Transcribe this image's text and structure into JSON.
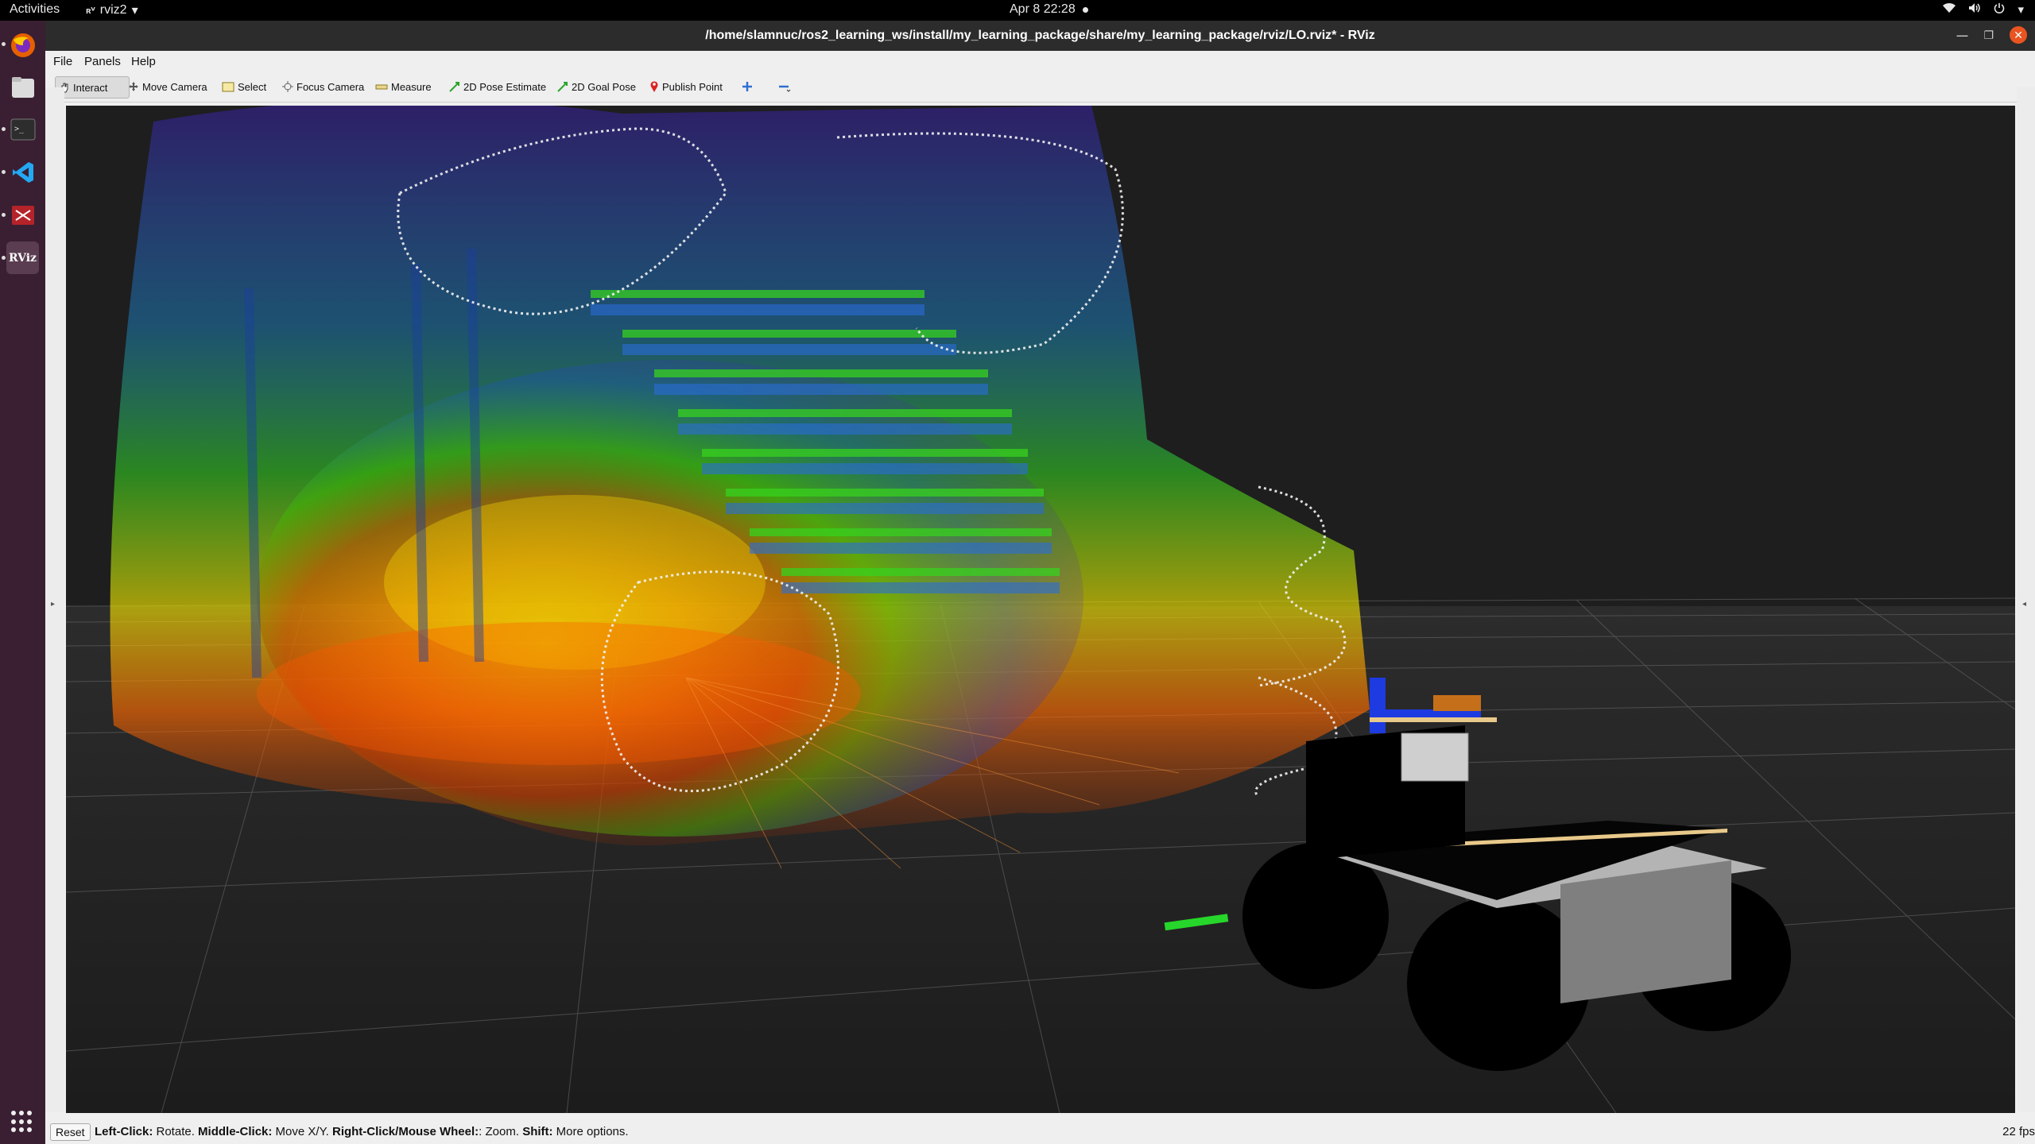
{
  "topbar": {
    "activities": "Activities",
    "app_name": "rviz2",
    "app_logo": "RViz",
    "clock": "Apr 8  22:28",
    "tray_icons": [
      "wifi-icon",
      "volume-icon",
      "power-icon"
    ]
  },
  "dock": {
    "items": [
      "firefox",
      "files",
      "terminal",
      "vscode",
      "app-red",
      "rviz"
    ],
    "rviz_label": "RViz"
  },
  "window": {
    "title": "/home/slamnuc/ros2_learning_ws/install/my_learning_package/share/my_learning_package/rviz/LO.rviz* - RViz"
  },
  "menu": {
    "file": "File",
    "panels": "Panels",
    "help": "Help"
  },
  "toolbar": {
    "interact": "Interact",
    "move_camera": "Move Camera",
    "select": "Select",
    "focus_camera": "Focus Camera",
    "measure": "Measure",
    "pose_estimate": "2D Pose Estimate",
    "goal_pose": "2D Goal Pose",
    "publish_point": "Publish Point"
  },
  "status": {
    "reset": "Reset",
    "hint_left_click": "Left-Click:",
    "hint_rotate": " Rotate. ",
    "hint_middle_click": "Middle-Click:",
    "hint_move": " Move X/Y. ",
    "hint_right_click": "Right-Click/Mouse Wheel:",
    "hint_zoom": ": Zoom. ",
    "hint_shift": "Shift:",
    "hint_more": " More options.",
    "fps": "22 fps"
  },
  "colors": {
    "view_background": "#1f1f1f",
    "accent_close": "#e95420",
    "dock_background": "#3a1f32"
  }
}
